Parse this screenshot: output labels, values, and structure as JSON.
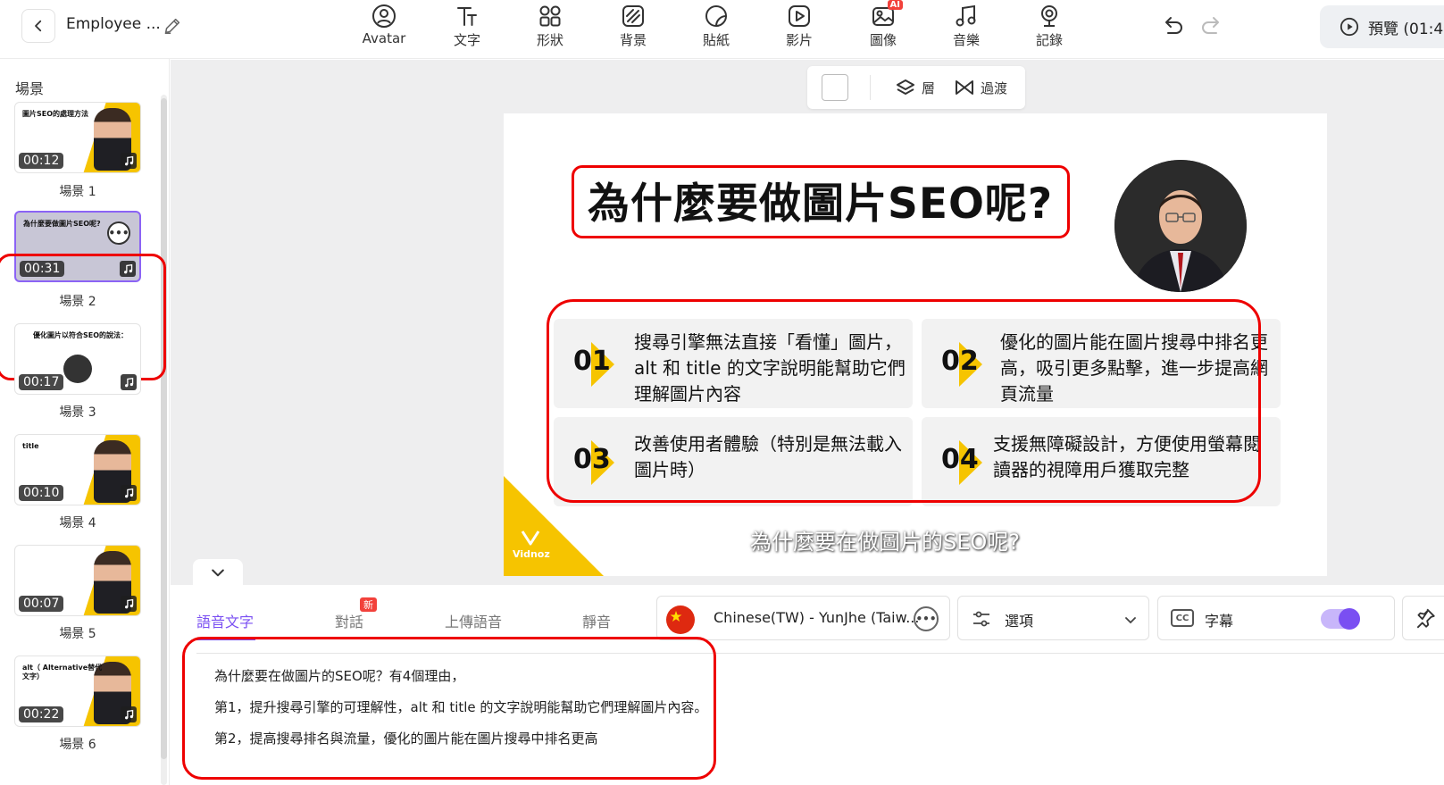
{
  "header": {
    "project_title": "Employee ...",
    "tools": [
      {
        "label": "Avatar",
        "icon": "avatar-icon"
      },
      {
        "label": "文字",
        "icon": "text-icon"
      },
      {
        "label": "形狀",
        "icon": "shapes-icon"
      },
      {
        "label": "背景",
        "icon": "background-icon"
      },
      {
        "label": "貼紙",
        "icon": "sticker-icon"
      },
      {
        "label": "影片",
        "icon": "video-icon"
      },
      {
        "label": "圖像",
        "icon": "image-icon",
        "badge": "AI"
      },
      {
        "label": "音樂",
        "icon": "music-icon"
      },
      {
        "label": "記錄",
        "icon": "record-icon"
      }
    ],
    "preview_label": "預覽 (01:4"
  },
  "scenes": {
    "heading": "場景",
    "items": [
      {
        "title": "圖片SEO的處理方法",
        "duration": "00:12",
        "label": "場景 1"
      },
      {
        "title": "為什麼要做圖片SEO呢?",
        "duration": "00:31",
        "label": "場景 2",
        "active": true
      },
      {
        "title": "優化圖片以符合SEO的說法：",
        "duration": "00:17",
        "label": "場景 3"
      },
      {
        "title": "title",
        "duration": "00:10",
        "label": "場景 4"
      },
      {
        "title": "",
        "duration": "00:07",
        "label": "場景 5"
      },
      {
        "title": "alt（ Alternative替代文字）",
        "duration": "00:22",
        "label": "場景 6"
      }
    ]
  },
  "context_bar": {
    "layer_label": "層",
    "transition_label": "過渡"
  },
  "slide": {
    "title": "為什麼要做圖片SEO呢?",
    "cards": [
      {
        "num": "01",
        "text": "搜尋引擎無法直接「看懂」圖片，alt 和 title 的文字說明能幫助它們理解圖片內容"
      },
      {
        "num": "02",
        "text": "優化的圖片能在圖片搜尋中排名更高，吸引更多點擊，進一步提高網頁流量"
      },
      {
        "num": "03",
        "text": "改善使用者體驗（特別是無法載入圖片時）"
      },
      {
        "num": "04",
        "text": "支援無障礙設計，方便使用螢幕閱讀器的視障用戶獲取完整"
      }
    ],
    "brand": "Vidnoz",
    "subtitle": "為什麼要在做圖片的SEO呢?"
  },
  "bottom": {
    "tabs": [
      {
        "label": "語音文字",
        "active": true
      },
      {
        "label": "對話",
        "badge": "新"
      },
      {
        "label": "上傳語音"
      },
      {
        "label": "靜音"
      }
    ],
    "voice_name": "Chinese(TW) - YunJhe (Taiw...",
    "options_label": "選項",
    "caption_label": "字幕",
    "caption_on": true,
    "script_lines": [
      "為什麼要在做圖片的SEO呢？有4個理由，",
      "第1，提升搜尋引擎的可理解性，alt 和 title 的文字說明能幫助它們理解圖片內容。",
      "第2，提高搜尋排名與流量，優化的圖片能在圖片搜尋中排名更高"
    ]
  },
  "colors": {
    "accent": "#7a4ff2",
    "brand_yellow": "#f6c400",
    "annotation_red": "#e00000"
  }
}
